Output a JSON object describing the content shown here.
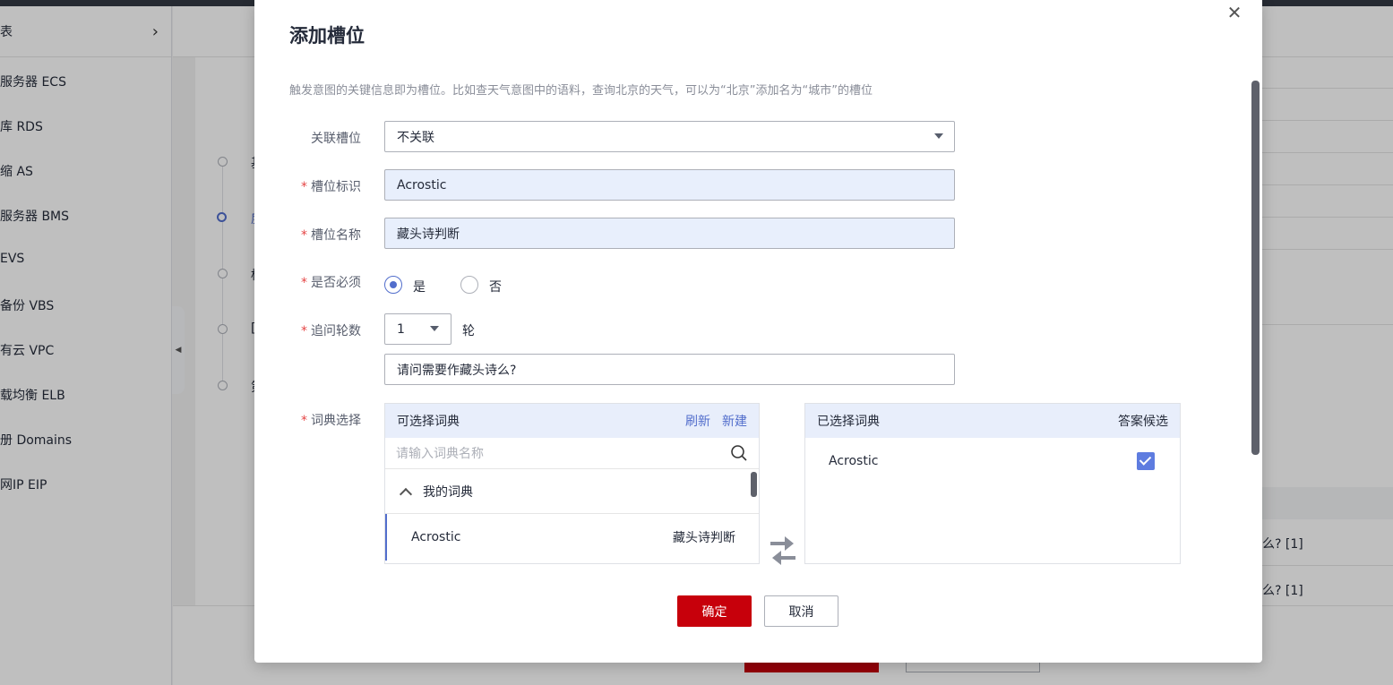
{
  "background": {
    "sidebar_header": "表",
    "sidebar_items": [
      "服务器 ECS",
      "库 RDS",
      "缩 AS",
      "服务器 BMS",
      " EVS",
      "备份 VBS",
      "有云 VPC",
      "载均衡 ELB",
      "册 Domains",
      "网IP EIP"
    ],
    "steps": [
      "基",
      "度",
      "档",
      "[",
      "第"
    ],
    "right_cells": [
      "么?  [1]",
      "么?  [1]"
    ]
  },
  "dialog": {
    "title": "添加槽位",
    "description": "触发意图的关键信息即为槽位。比如查天气意图中的语料，查询北京的天气，可以为“北京”添加名为“城市”的槽位",
    "fields": {
      "related_slot": {
        "label": "关联槽位",
        "value": "不关联"
      },
      "slot_id": {
        "label": "槽位标识",
        "value": "Acrostic"
      },
      "slot_name": {
        "label": "槽位名称",
        "value": "藏头诗判断"
      },
      "required": {
        "label": "是否必须",
        "yes": "是",
        "no": "否",
        "selected": "是"
      },
      "followup": {
        "label": "追问轮数",
        "value": "1",
        "unit": "轮",
        "question": "请问需要作藏头诗么?"
      },
      "dictionary": {
        "label": "词典选择"
      }
    },
    "available": {
      "title": "可选择词典",
      "refresh": "刷新",
      "new": "新建",
      "search_placeholder": "请输入词典名称",
      "group": "我的词典",
      "items": [
        {
          "name": "Acrostic",
          "desc": "藏头诗判断"
        }
      ]
    },
    "selected": {
      "title": "已选择词典",
      "answer_candidate": "答案候选",
      "items": [
        {
          "name": "Acrostic",
          "checked": true
        }
      ]
    },
    "buttons": {
      "confirm": "确定",
      "cancel": "取消"
    }
  },
  "colors": {
    "primary": "#c7000b",
    "accent": "#526ecc"
  }
}
